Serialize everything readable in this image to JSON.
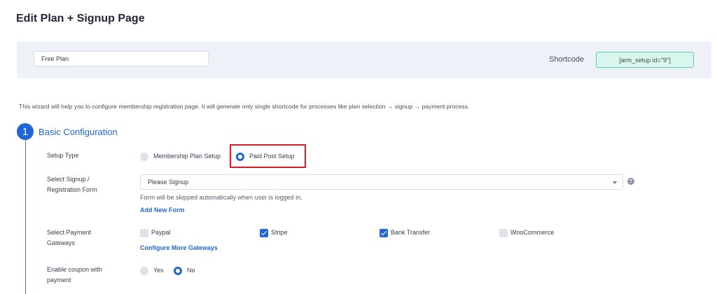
{
  "page": {
    "title": "Edit Plan + Signup Page"
  },
  "plan": {
    "name_value": "Free Plan",
    "shortcode_label": "Shortcode",
    "shortcode_value": "[arm_setup id=\"9\"]"
  },
  "intro": "This wizard will help you to configure membership registration page. It will generate only single shortcode for processes like plan selection → signup → payment process.",
  "step": {
    "number": "1",
    "title": "Basic Configuration"
  },
  "setup_type": {
    "label": "Setup Type",
    "options": [
      {
        "label": "Membership Plan Setup",
        "selected": false
      },
      {
        "label": "Paid Post Setup",
        "selected": true
      }
    ]
  },
  "signup_form": {
    "label_line1": "Select Signup /",
    "label_line2": "Registration Form",
    "selected_value": "Please Signup",
    "hint": "Form will be skipped automatically when user is logged in.",
    "add_link": "Add New Form",
    "help_icon": "?"
  },
  "gateways": {
    "label_line1": "Select Payment",
    "label_line2": "Gateways",
    "items": [
      {
        "label": "Paypal",
        "checked": false
      },
      {
        "label": "Stripe",
        "checked": true
      },
      {
        "label": "Bank Transfer",
        "checked": true
      },
      {
        "label": "WooCommerce",
        "checked": false
      }
    ],
    "configure_link": "Configure More Gateways"
  },
  "coupon": {
    "label_line1": "Enable coupon with",
    "label_line2": "payment",
    "options": [
      {
        "label": "Yes",
        "selected": false
      },
      {
        "label": "No",
        "selected": true
      }
    ]
  },
  "colors": {
    "accent": "#2166d6",
    "highlight": "#d4202b",
    "shortcode_bg": "#d9f6ee"
  }
}
